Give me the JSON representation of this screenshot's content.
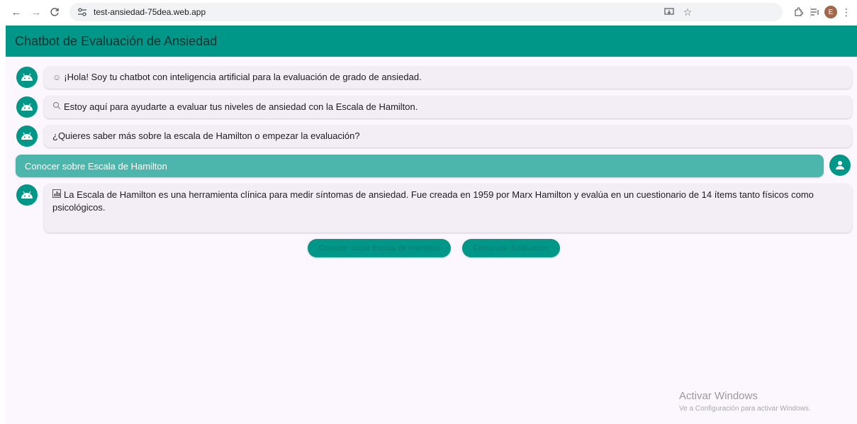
{
  "browser": {
    "url": "test-ansiedad-75dea.web.app",
    "profile_initial": "E"
  },
  "app": {
    "title": "Chatbot de Evaluación de Ansiedad",
    "accent_color": "#009688",
    "user_bubble_color": "#4db6ac"
  },
  "messages": [
    {
      "sender": "bot",
      "icon": "smile-icon",
      "icon_glyph": "☺",
      "text": "¡Hola! Soy tu chatbot con inteligencia artificial para la evaluación de  grado de ansiedad."
    },
    {
      "sender": "bot",
      "icon": "magnifier-icon",
      "icon_glyph": "🔍",
      "text": "Estoy aquí para ayudarte a evaluar tus niveles de ansiedad con la Escala de Hamilton."
    },
    {
      "sender": "bot",
      "icon": "",
      "icon_glyph": "",
      "text": "¿Quieres saber más sobre la escala de Hamilton o empezar la evaluación?"
    },
    {
      "sender": "user",
      "text": "Conocer sobre Escala de Hamilton"
    },
    {
      "sender": "bot",
      "icon": "bar-chart-icon",
      "icon_glyph": "📊",
      "text": "La Escala de Hamilton es una herramienta clínica para medir síntomas de ansiedad. Fue creada en 1959 por Marx Hamilton y evalúa en un cuestionario de 14 ítems tanto físicos como psicológicos."
    }
  ],
  "actions": {
    "learn_label": "Conocer sobre Escala de Hamilton",
    "start_label": "Comenzar Evaluación"
  },
  "watermark": {
    "title": "Activar Windows",
    "subtitle": "Ve a Configuración para activar Windows."
  }
}
